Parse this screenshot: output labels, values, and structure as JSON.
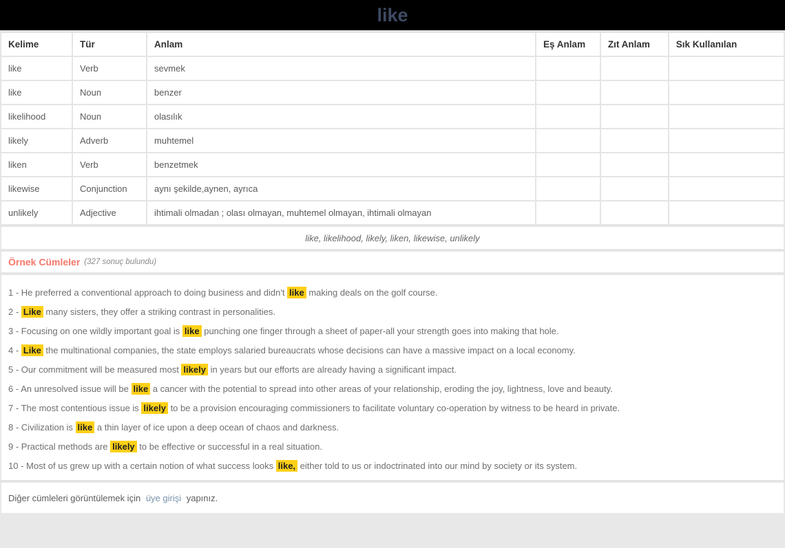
{
  "header": {
    "title": "like"
  },
  "table": {
    "columns": [
      "Kelime",
      "Tür",
      "Anlam",
      "Eş Anlam",
      "Zıt Anlam",
      "Sık Kullanılan"
    ],
    "rows": [
      {
        "word": "like",
        "type": "Verb",
        "meaning": "sevmek",
        "synonym": "",
        "antonym": "",
        "common": "",
        "active": true
      },
      {
        "word": "like",
        "type": "Noun",
        "meaning": "benzer",
        "synonym": "",
        "antonym": "",
        "common": "",
        "active": false
      },
      {
        "word": "likelihood",
        "type": "Noun",
        "meaning": "olasılık",
        "synonym": "",
        "antonym": "",
        "common": "",
        "active": false
      },
      {
        "word": "likely",
        "type": "Adverb",
        "meaning": "muhtemel",
        "synonym": "",
        "antonym": "",
        "common": "",
        "active": false
      },
      {
        "word": "liken",
        "type": "Verb",
        "meaning": "benzetmek",
        "synonym": "",
        "antonym": "",
        "common": "",
        "active": false
      },
      {
        "word": "likewise",
        "type": "Conjunction",
        "meaning": "aynı şekilde,aynen, ayrıca",
        "synonym": "",
        "antonym": "",
        "common": "",
        "active": false
      },
      {
        "word": "unlikely",
        "type": "Adjective",
        "meaning": "ihtimali olmadan ; olası olmayan, muhtemel olmayan, ihtimali olmayan",
        "synonym": "",
        "antonym": "",
        "common": "",
        "active": false
      }
    ]
  },
  "related_words": "like, likelihood, likely, liken, likewise, unlikely",
  "examples": {
    "title": "Örnek Cümleler",
    "count_label": "(327 sonuç bulundu)",
    "sentences": [
      {
        "number": "1 - ",
        "before": "He preferred a conventional approach to doing business and didn't ",
        "highlight": "like",
        "after": " making deals on the golf course."
      },
      {
        "number": "2 - ",
        "before": "",
        "highlight": "Like",
        "after": " many sisters, they offer a striking contrast in personalities."
      },
      {
        "number": "3 - ",
        "before": "Focusing on one wildly important goal is ",
        "highlight": "like",
        "after": " punching one finger through a sheet of paper-all your strength goes into making that hole."
      },
      {
        "number": "4 - ",
        "before": "",
        "highlight": "Like",
        "after": " the multinational companies, the state employs salaried bureaucrats whose decisions can have a massive impact on a local economy."
      },
      {
        "number": "5 - ",
        "before": "Our commitment will be measured most ",
        "highlight": "likely",
        "after": " in years but our efforts are already having a significant impact."
      },
      {
        "number": "6 - ",
        "before": "An unresolved issue will be ",
        "highlight": "like",
        "after": " a cancer with the potential to spread into other areas of your relationship, eroding the joy, lightness, love and beauty."
      },
      {
        "number": "7 - ",
        "before": "The most contentious issue is ",
        "highlight": "likely",
        "after": " to be a provision encouraging commissioners to facilitate voluntary co-operation by witness to be heard in private."
      },
      {
        "number": "8 - ",
        "before": "Civilization is ",
        "highlight": "like",
        "after": " a thin layer of ice upon a deep ocean of chaos and darkness."
      },
      {
        "number": "9 - ",
        "before": "Practical methods are ",
        "highlight": "likely",
        "after": " to be effective or successful in a real situation."
      },
      {
        "number": "10 - ",
        "before": "Most of us grew up with a certain notion of what success looks ",
        "highlight": "like,",
        "after": " either told to us or indoctrinated into our mind by society or its system."
      }
    ]
  },
  "footer": {
    "text_before": "Diğer cümleleri görüntülemek için ",
    "link_text": "üye girişi",
    "text_after": " yapınız."
  },
  "colors": {
    "header_bg": "#000000",
    "header_title": "#3e4a63",
    "active_word": "#6cb6e3",
    "examples_title": "#f4776a",
    "highlight_bg": "#fdd017",
    "link": "#7b92ab",
    "page_bg": "#e5e5e5"
  }
}
